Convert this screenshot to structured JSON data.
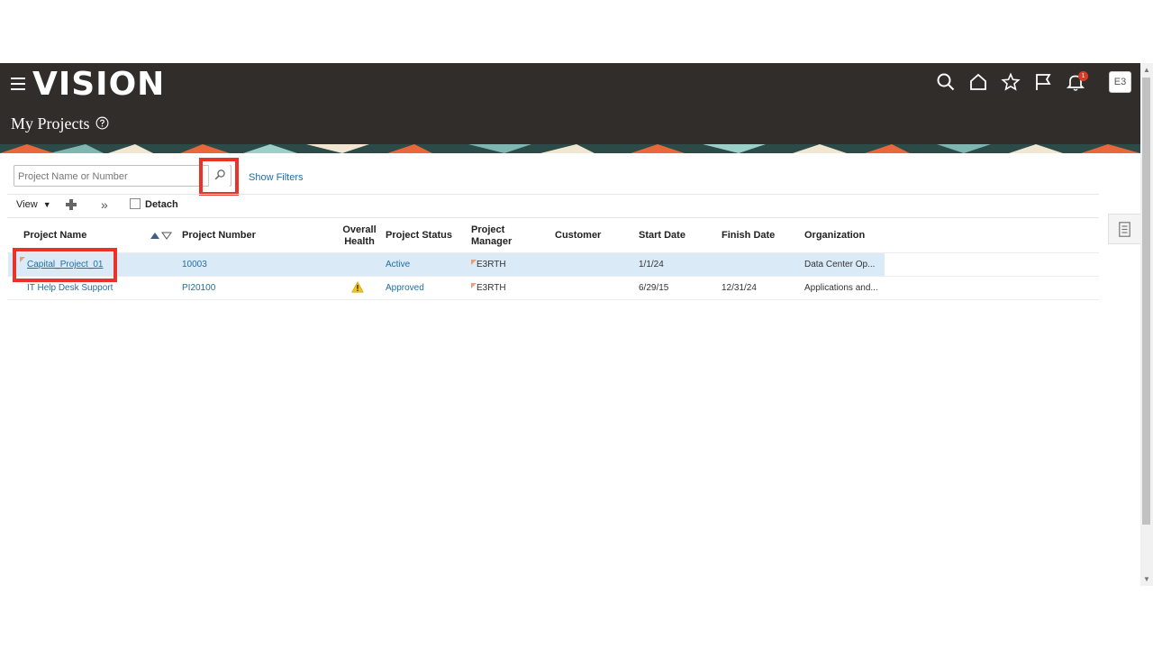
{
  "app": {
    "logo_text": "VISION"
  },
  "page": {
    "title": "My Projects"
  },
  "header_icons": [
    "search-icon",
    "home-icon",
    "star-icon",
    "flag-icon",
    "bell-icon"
  ],
  "notifications": {
    "count": "1"
  },
  "user": {
    "initials": "E3"
  },
  "search": {
    "placeholder": "Project Name or Number",
    "value": "",
    "show_filters_label": "Show Filters"
  },
  "toolbar": {
    "view_label": "View",
    "detach_label": "Detach"
  },
  "table": {
    "columns": {
      "name": "Project Name",
      "number": "Project Number",
      "health_1": "Overall",
      "health_2": "Health",
      "status": "Project Status",
      "manager_1": "Project",
      "manager_2": "Manager",
      "customer": "Customer",
      "start": "Start Date",
      "finish": "Finish Date",
      "org": "Organization"
    },
    "rows": [
      {
        "name": "Capital_Project_01",
        "number": "10003",
        "health": "",
        "status": "Active",
        "manager": "E3RTH",
        "customer": "",
        "start": "1/1/24",
        "finish": "",
        "org": "Data Center Op..."
      },
      {
        "name": "IT Help Desk Support",
        "number": "PI20100",
        "health": "warning",
        "status": "Approved",
        "manager": "E3RTH",
        "customer": "",
        "start": "6/29/15",
        "finish": "12/31/24",
        "org": "Applications and..."
      }
    ]
  },
  "colors": {
    "header_bg": "#312d2a",
    "link": "#1d6fa5",
    "selected_row": "#dbeaf7",
    "highlight": "#e8322a",
    "warning": "#f0c419"
  }
}
